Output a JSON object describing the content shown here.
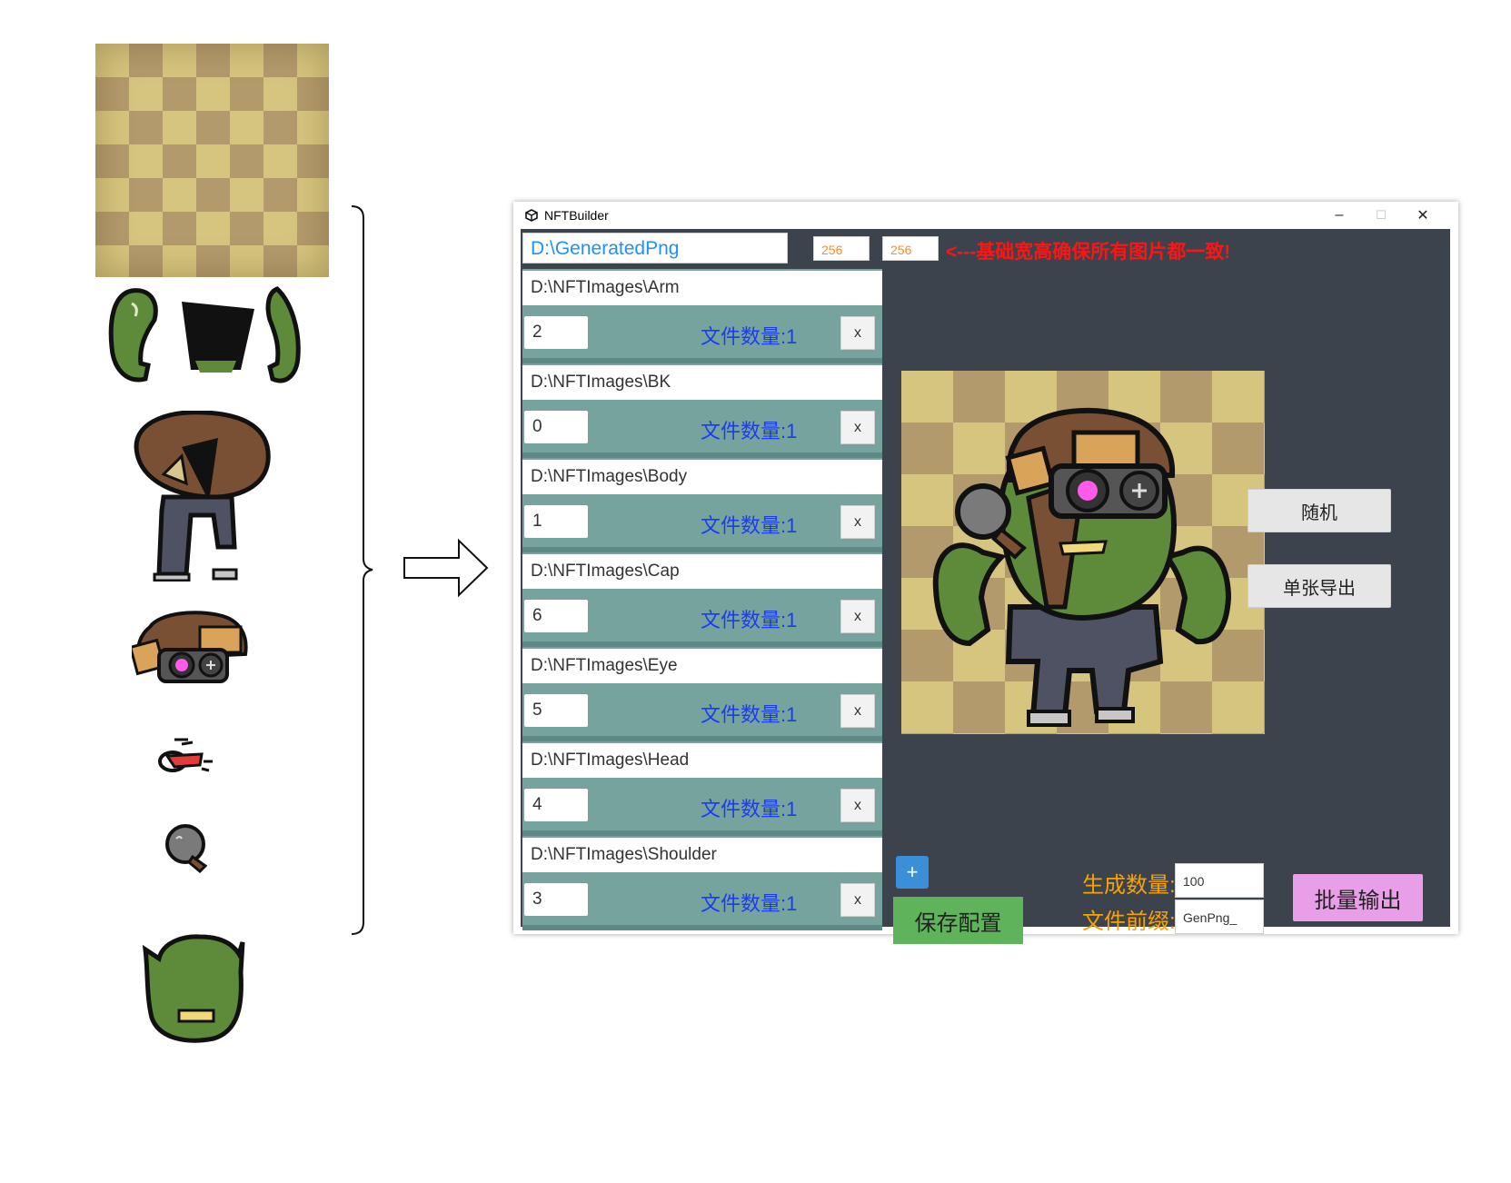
{
  "window": {
    "title": "NFTBuilder",
    "minimize_glyph": "–",
    "maximize_glyph": "☐",
    "close_glyph": "✕"
  },
  "output": {
    "path": "D:\\GeneratedPng",
    "width": "256",
    "height": "256",
    "warning": "<---基础宽高确保所有图片都一致!"
  },
  "layers": [
    {
      "path": "D:\\NFTImages\\Arm",
      "value": "2",
      "count_label": "文件数量:1",
      "remove_label": "x"
    },
    {
      "path": "D:\\NFTImages\\BK",
      "value": "0",
      "count_label": "文件数量:1",
      "remove_label": "x"
    },
    {
      "path": "D:\\NFTImages\\Body",
      "value": "1",
      "count_label": "文件数量:1",
      "remove_label": "x"
    },
    {
      "path": "D:\\NFTImages\\Cap",
      "value": "6",
      "count_label": "文件数量:1",
      "remove_label": "x"
    },
    {
      "path": "D:\\NFTImages\\Eye",
      "value": "5",
      "count_label": "文件数量:1",
      "remove_label": "x"
    },
    {
      "path": "D:\\NFTImages\\Head",
      "value": "4",
      "count_label": "文件数量:1",
      "remove_label": "x"
    },
    {
      "path": "D:\\NFTImages\\Shoulder",
      "value": "3",
      "count_label": "文件数量:1",
      "remove_label": "x"
    }
  ],
  "buttons": {
    "random": "随机",
    "export_single": "单张导出",
    "add": "+",
    "save_config": "保存配置",
    "batch_export": "批量输出"
  },
  "generation": {
    "count_label": "生成数量:",
    "count_value": "100",
    "prefix_label": "文件前缀:",
    "prefix_value": "GenPng_"
  },
  "colors": {
    "client_bg": "#3d434c",
    "layer_bg": "#76a39e",
    "path_blue": "#1e90ff",
    "count_blue": "#1a3df0",
    "warning_red": "#ff1414",
    "label_orange": "#f7a300",
    "save_green": "#5fb35a",
    "batch_pink": "#e99fe8",
    "add_blue": "#3b8fd9"
  }
}
